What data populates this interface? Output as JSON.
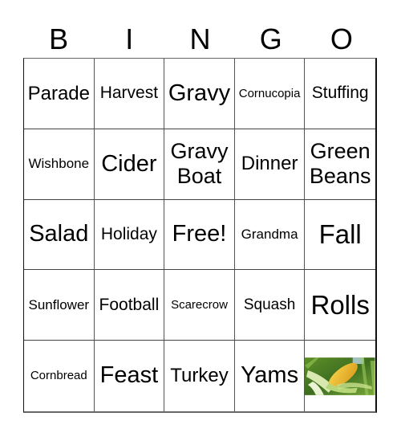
{
  "header": {
    "letters": [
      "B",
      "I",
      "N",
      "G",
      "O"
    ]
  },
  "card": {
    "rows": [
      [
        "Parade",
        "Harvest",
        "Gravy",
        "Cornucopia",
        "Stuffing"
      ],
      [
        "Wishbone",
        "Cider",
        "Gravy Boat",
        "Dinner",
        "Green Beans"
      ],
      [
        "Salad",
        "Holiday",
        "Free!",
        "Grandma",
        "Fall"
      ],
      [
        "Sunflower",
        "Football",
        "Scarecrow",
        "Squash",
        "Rolls"
      ],
      [
        "Cornbread",
        "Feast",
        "Turkey",
        "Yams",
        ""
      ]
    ],
    "image_cell": {
      "icon": "corn-cob-image",
      "description": "Ear of corn in a cornfield"
    },
    "colors": {
      "line": "#444444",
      "text": "#000000",
      "background": "#ffffff"
    }
  }
}
